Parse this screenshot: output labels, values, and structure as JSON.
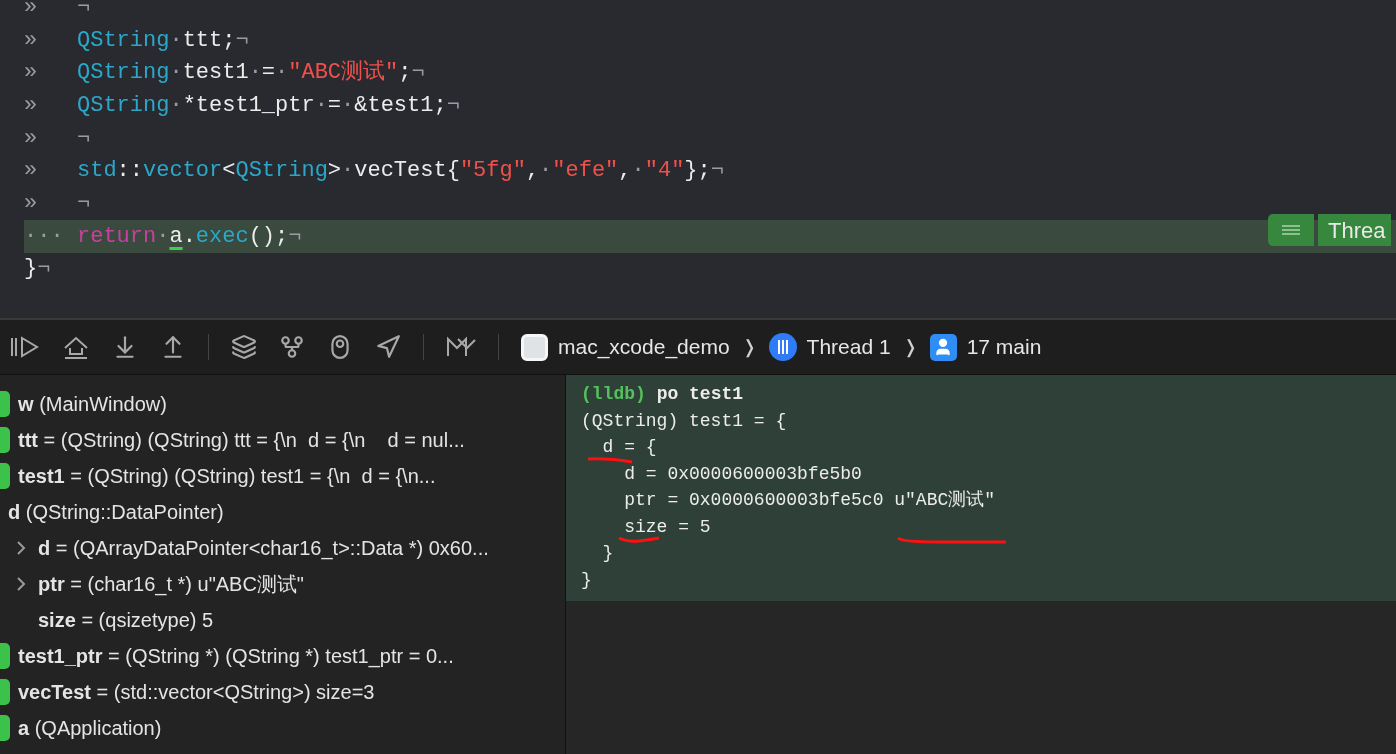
{
  "editor": {
    "lines": [
      {
        "gutter": "»",
        "current": false,
        "tokens": [
          {
            "text": "¬",
            "kind": "invisible"
          }
        ]
      },
      {
        "gutter": "»",
        "current": false,
        "tokens": [
          {
            "text": "QString",
            "kind": "type"
          },
          {
            "text": "·",
            "kind": "invisible"
          },
          {
            "text": "ttt;",
            "kind": "plain"
          },
          {
            "text": "¬",
            "kind": "invisible"
          }
        ]
      },
      {
        "gutter": "»",
        "current": false,
        "tokens": [
          {
            "text": "QString",
            "kind": "type"
          },
          {
            "text": "·",
            "kind": "invisible"
          },
          {
            "text": "test1",
            "kind": "plain"
          },
          {
            "text": "·",
            "kind": "invisible"
          },
          {
            "text": "=",
            "kind": "plain"
          },
          {
            "text": "·",
            "kind": "invisible"
          },
          {
            "text": "\"ABC测试\"",
            "kind": "string"
          },
          {
            "text": ";",
            "kind": "plain"
          },
          {
            "text": "¬",
            "kind": "invisible"
          }
        ]
      },
      {
        "gutter": "»",
        "current": false,
        "tokens": [
          {
            "text": "QString",
            "kind": "type"
          },
          {
            "text": "·",
            "kind": "invisible"
          },
          {
            "text": "*test1_ptr",
            "kind": "plain"
          },
          {
            "text": "·",
            "kind": "invisible"
          },
          {
            "text": "=",
            "kind": "plain"
          },
          {
            "text": "·",
            "kind": "invisible"
          },
          {
            "text": "&test1;",
            "kind": "plain"
          },
          {
            "text": "¬",
            "kind": "invisible"
          }
        ]
      },
      {
        "gutter": "»",
        "current": false,
        "tokens": [
          {
            "text": "¬",
            "kind": "invisible"
          }
        ]
      },
      {
        "gutter": "»",
        "current": false,
        "tokens": [
          {
            "text": "std",
            "kind": "type"
          },
          {
            "text": "::",
            "kind": "plain"
          },
          {
            "text": "vector",
            "kind": "type"
          },
          {
            "text": "<",
            "kind": "plain"
          },
          {
            "text": "QString",
            "kind": "type"
          },
          {
            "text": ">",
            "kind": "plain"
          },
          {
            "text": "·",
            "kind": "invisible"
          },
          {
            "text": "vecTest{",
            "kind": "plain"
          },
          {
            "text": "\"5fg\"",
            "kind": "string"
          },
          {
            "text": ",",
            "kind": "plain"
          },
          {
            "text": "·",
            "kind": "invisible"
          },
          {
            "text": "\"efe\"",
            "kind": "string"
          },
          {
            "text": ",",
            "kind": "plain"
          },
          {
            "text": "·",
            "kind": "invisible"
          },
          {
            "text": "\"4\"",
            "kind": "string"
          },
          {
            "text": "};",
            "kind": "plain"
          },
          {
            "text": "¬",
            "kind": "invisible"
          }
        ]
      },
      {
        "gutter": "»",
        "current": false,
        "tokens": [
          {
            "text": "¬",
            "kind": "invisible"
          }
        ]
      },
      {
        "gutter": "···",
        "current": true,
        "tokens": [
          {
            "text": "return",
            "kind": "keyword"
          },
          {
            "text": "·",
            "kind": "invisible"
          },
          {
            "text": "a",
            "kind": "marked"
          },
          {
            "text": ".",
            "kind": "plain"
          },
          {
            "text": "exec",
            "kind": "func"
          },
          {
            "text": "();",
            "kind": "plain"
          },
          {
            "text": "¬",
            "kind": "invisible"
          }
        ]
      },
      {
        "current": false,
        "tokens": [
          {
            "text": "}",
            "kind": "plain"
          },
          {
            "text": "¬",
            "kind": "invisible"
          }
        ]
      }
    ],
    "thread_badge": {
      "label": "Threa"
    }
  },
  "debug_bar": {
    "breadcrumbs": [
      {
        "label": "mac_xcode_demo",
        "kind": "app"
      },
      {
        "label": "Thread 1",
        "kind": "thread"
      },
      {
        "label": "17 main",
        "kind": "frame"
      }
    ],
    "separators": [
      "❭",
      "❭"
    ]
  },
  "variables": [
    {
      "kind": "local",
      "name": "w",
      "detail": "(MainWindow)"
    },
    {
      "kind": "local",
      "name": "ttt",
      "detail": "= (QString) (QString) ttt = {\\n  d = {\\n    d = nul..."
    },
    {
      "kind": "local",
      "name": "test1",
      "detail": "= (QString) (QString) test1 = {\\n  d = {\\n...",
      "children": [
        {
          "kind": "member",
          "name": "d",
          "detail": "(QString::DataPointer)",
          "children": [
            {
              "kind": "member",
              "name": "d",
              "detail": "= (QArrayDataPointer<char16_t>::Data *) 0x60...",
              "expanded": false
            },
            {
              "kind": "member",
              "name": "ptr",
              "detail": "= (char16_t *) u\"ABC测试\"",
              "expanded": false
            },
            {
              "kind": "member",
              "name": "size",
              "detail": "= (qsizetype) 5"
            }
          ]
        }
      ]
    },
    {
      "kind": "local",
      "name": "test1_ptr",
      "detail": "= (QString *) (QString *) test1_ptr = 0..."
    },
    {
      "kind": "local",
      "name": "vecTest",
      "detail": "= (std::vector<QString>) size=3"
    },
    {
      "kind": "local",
      "name": "a",
      "detail": "(QApplication)"
    }
  ],
  "console": {
    "prompt": "(lldb)",
    "command": "po test1",
    "output": [
      "(QString) test1 = {",
      "  d = {",
      "    d = 0x0000600003bfe5b0",
      "    ptr = 0x0000600003bfe5c0 u\"ABC测试\"",
      "    size = 5",
      "  }",
      "}"
    ]
  }
}
